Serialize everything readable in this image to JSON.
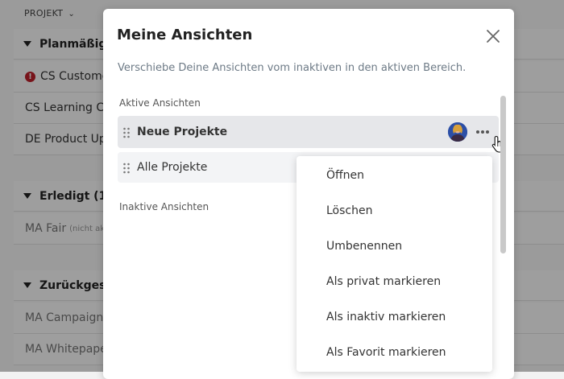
{
  "background": {
    "header_label": "PROJEKT",
    "groups": [
      {
        "label": "Planmäßig"
      },
      {
        "label": "Erledigt (1)"
      },
      {
        "label": "Zurückgeste"
      }
    ],
    "rows": [
      {
        "label": "CS Customer"
      },
      {
        "label": "CS Learning Ce"
      },
      {
        "label": "DE Product Up"
      },
      {
        "label": "MA Fair",
        "note": "(nicht akt"
      },
      {
        "label": "MA Campaign"
      },
      {
        "label": "MA Whitepape"
      }
    ]
  },
  "modal": {
    "title": "Meine Ansichten",
    "description": "Verschiebe Deine Ansichten vom inaktiven in den aktiven Bereich.",
    "active_section_label": "Aktive Ansichten",
    "inactive_section_label": "Inaktive Ansichten",
    "active_views": [
      {
        "name": "Neue Projekte"
      },
      {
        "name": "Alle Projekte"
      }
    ]
  },
  "context_menu": {
    "items": [
      {
        "label": "Öffnen"
      },
      {
        "label": "Löschen"
      },
      {
        "label": "Umbenennen"
      },
      {
        "label": "Als privat markieren"
      },
      {
        "label": "Als inaktiv markieren"
      },
      {
        "label": "Als Favorit markieren"
      }
    ]
  },
  "colors": {
    "error": "#c0202b",
    "avatar": "#2c4fa6",
    "description_text": "#6d7a86",
    "selected_row": "#e6e7ea"
  },
  "icons": [
    "chevron-down-icon",
    "error-icon",
    "close-icon",
    "drag-handle-icon",
    "avatar",
    "more-horizontal-icon",
    "hand-cursor-icon"
  ]
}
